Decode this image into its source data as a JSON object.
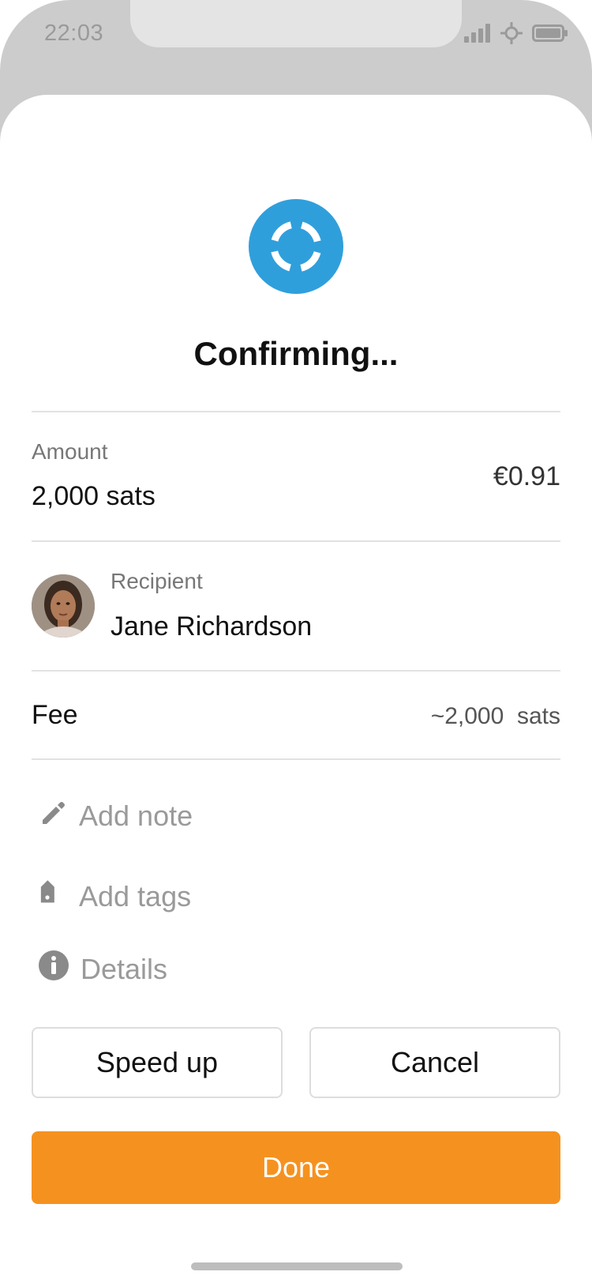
{
  "status_bar": {
    "time": "22:03",
    "icons": [
      "signal-icon",
      "crosshair-icon",
      "battery-icon"
    ]
  },
  "header": {
    "status_icon": "loading-spinner-icon",
    "title": "Confirming..."
  },
  "amount": {
    "label": "Amount",
    "value": "2,000 sats",
    "fiat": "€0.91"
  },
  "recipient": {
    "label": "Recipient",
    "name": "Jane Richardson",
    "avatar": "avatar-photo"
  },
  "fee": {
    "label": "Fee",
    "value": "~2,000  sats"
  },
  "actions": {
    "add_note": "Add note",
    "add_tags": "Add tags",
    "details": "Details"
  },
  "buttons": {
    "speed_up": "Speed up",
    "cancel": "Cancel",
    "done": "Done"
  },
  "colors": {
    "accent": "#f5921f",
    "status_blue": "#2f9fdc"
  }
}
